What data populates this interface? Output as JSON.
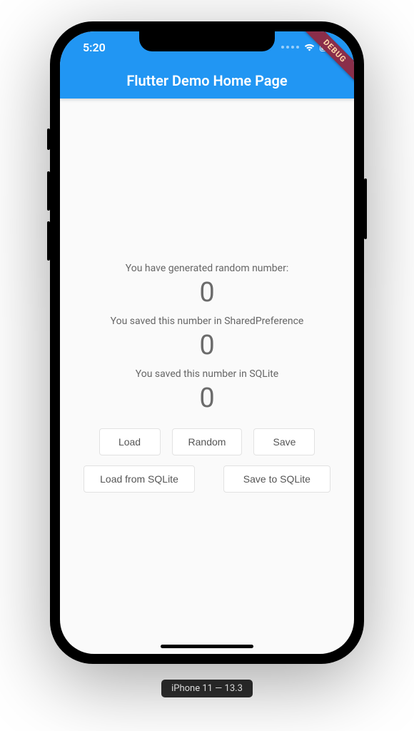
{
  "status": {
    "time": "5:20"
  },
  "debug_label": "DEBUG",
  "appbar": {
    "title": "Flutter Demo Home Page"
  },
  "main": {
    "generated_label": "You have generated random number:",
    "generated_value": "0",
    "sharedpref_label": "You saved this number in SharedPreference",
    "sharedpref_value": "0",
    "sqlite_label": "You saved this number in SQLite",
    "sqlite_value": "0"
  },
  "buttons": {
    "load": "Load",
    "random": "Random",
    "save": "Save",
    "load_sqlite": "Load from SQLite",
    "save_sqlite": "Save to SQLite"
  },
  "device": {
    "label": "iPhone 11 — 13.3"
  }
}
